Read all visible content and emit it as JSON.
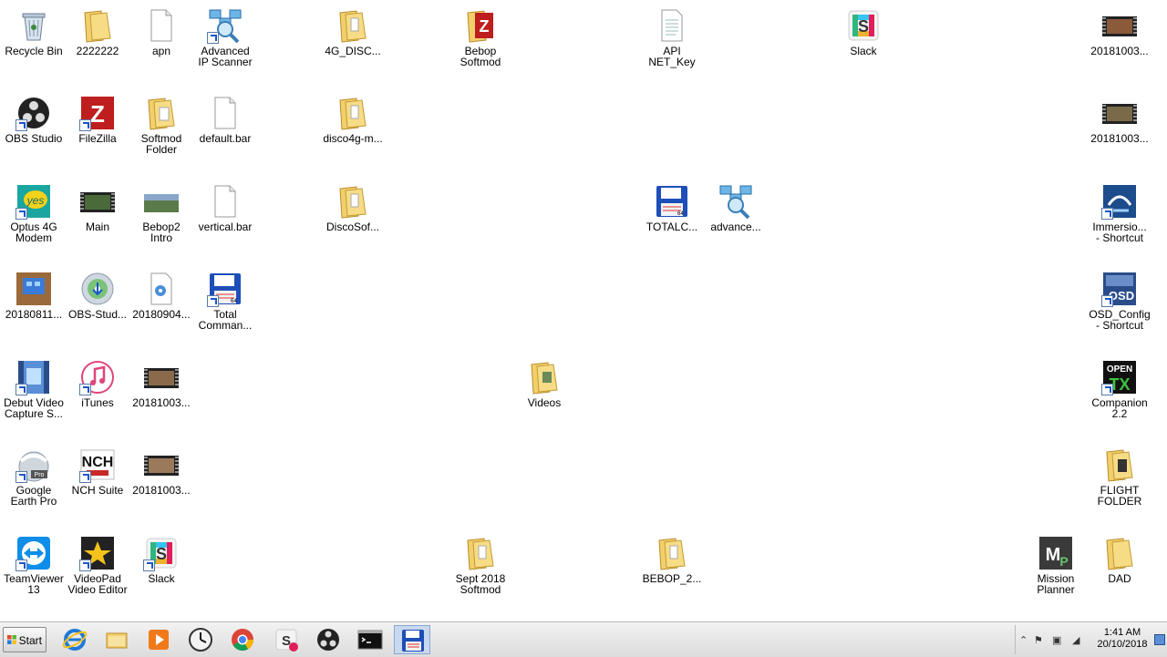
{
  "desktop": {
    "icons": [
      {
        "label": "Recycle Bin",
        "icon": "recycle-bin-icon"
      },
      {
        "label": "2222222",
        "icon": "folder-icon"
      },
      {
        "label": "apn",
        "icon": "file-icon"
      },
      {
        "label": "Advanced\nIP Scanner",
        "icon": "network-scanner-icon"
      },
      {
        "label": "4G_DISC...",
        "icon": "folder-icon"
      },
      {
        "label": "Bebop\nSoftmod",
        "icon": "filezilla-folder-icon"
      },
      {
        "label": "API\nNET_Key",
        "icon": "text-file-icon"
      },
      {
        "label": "Slack",
        "icon": "slack-icon"
      },
      {
        "label": "20181003...",
        "icon": "video-icon"
      },
      {
        "label": "OBS Studio",
        "icon": "obs-icon"
      },
      {
        "label": "FileZilla",
        "icon": "filezilla-icon"
      },
      {
        "label": "Softmod\nFolder",
        "icon": "folder-icon"
      },
      {
        "label": "default.bar",
        "icon": "file-icon"
      },
      {
        "label": "disco4g-m...",
        "icon": "folder-icon"
      },
      {
        "label": "20181003...",
        "icon": "video-icon"
      },
      {
        "label": "Optus 4G\nModem",
        "icon": "optus-icon"
      },
      {
        "label": "Main",
        "icon": "video-icon"
      },
      {
        "label": "Bebop2\nIntro",
        "icon": "video-icon"
      },
      {
        "label": "vertical.bar",
        "icon": "file-icon"
      },
      {
        "label": "DiscoSof...",
        "icon": "folder-icon"
      },
      {
        "label": "TOTALC...",
        "icon": "floppy-icon"
      },
      {
        "label": "advance...",
        "icon": "network-scanner-icon"
      },
      {
        "label": "Immersio...\n- Shortcut",
        "icon": "immersion-icon"
      },
      {
        "label": "20180811...",
        "icon": "image-icon"
      },
      {
        "label": "OBS-Stud...",
        "icon": "installer-disc-icon"
      },
      {
        "label": "20180904...",
        "icon": "audio-file-icon"
      },
      {
        "label": "Total\nComman...",
        "icon": "floppy-icon"
      },
      {
        "label": "OSD_Config\n- Shortcut",
        "icon": "osd-icon"
      },
      {
        "label": "Debut Video\nCapture S...",
        "icon": "debut-video-icon"
      },
      {
        "label": "iTunes",
        "icon": "itunes-icon"
      },
      {
        "label": "20181003...",
        "icon": "video-icon"
      },
      {
        "label": "Videos",
        "icon": "folder-icon"
      },
      {
        "label": "Companion\n2.2",
        "icon": "opentx-icon"
      },
      {
        "label": "Google\nEarth Pro",
        "icon": "google-earth-icon"
      },
      {
        "label": "NCH Suite",
        "icon": "nch-icon"
      },
      {
        "label": "20181003...",
        "icon": "video-icon"
      },
      {
        "label": "FLIGHT\nFOLDER",
        "icon": "folder-icon"
      },
      {
        "label": "TeamViewer\n13",
        "icon": "teamviewer-icon"
      },
      {
        "label": "VideoPad\nVideo Editor",
        "icon": "videopad-icon"
      },
      {
        "label": "Slack",
        "icon": "slack-icon"
      },
      {
        "label": "Sept 2018\nSoftmod",
        "icon": "folder-icon"
      },
      {
        "label": "BEBOP_2...",
        "icon": "folder-icon"
      },
      {
        "label": "Mission\nPlanner",
        "icon": "mission-planner-icon"
      },
      {
        "label": "DAD",
        "icon": "folder-icon"
      }
    ]
  },
  "taskbar": {
    "start_label": "Start",
    "buttons": [
      {
        "icon": "internet-explorer-icon"
      },
      {
        "icon": "file-explorer-icon"
      },
      {
        "icon": "media-player-icon"
      },
      {
        "icon": "clock-app-icon"
      },
      {
        "icon": "chrome-icon"
      },
      {
        "icon": "slack-icon"
      },
      {
        "icon": "obs-icon"
      },
      {
        "icon": "command-prompt-icon"
      },
      {
        "icon": "total-commander-icon"
      }
    ],
    "clock": {
      "time": "1:41 AM",
      "date": "20/10/2018"
    }
  }
}
